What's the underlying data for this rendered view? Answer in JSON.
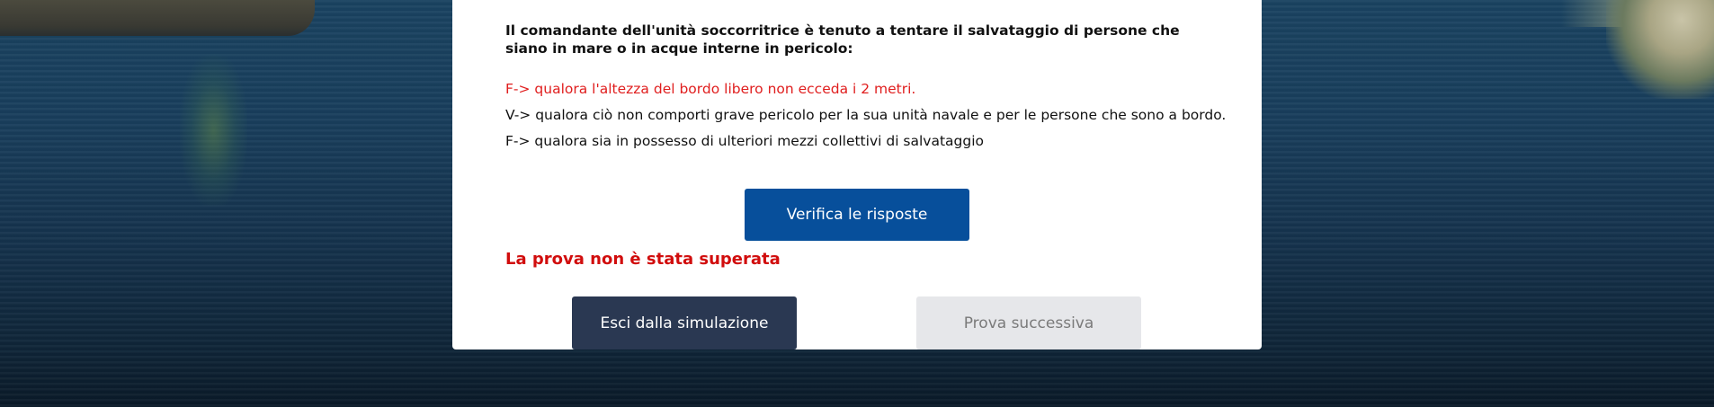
{
  "quiz": {
    "question": "Il comandante dell'unità soccorritrice è tenuto a tentare il salvataggio di persone che siano in mare o in acque interne in pericolo:",
    "answers": [
      {
        "text": "F-> qualora l'altezza del bordo libero non ecceda i 2 metri.",
        "status": "wrong",
        "color": "#e01e1e"
      },
      {
        "text": "V-> qualora ciò non comporti grave pericolo per la sua unità navale e per le persone che sono a bordo.",
        "status": "correct",
        "color": "#111111"
      },
      {
        "text": "F-> qualora sia in possesso di ulteriori mezzi collettivi di salvataggio",
        "status": "correct",
        "color": "#111111"
      }
    ],
    "verify_label": "Verifica le risposte",
    "result_text": "La prova non è stata superata",
    "exit_label": "Esci dalla simulazione",
    "next_label": "Prova successiva",
    "next_disabled": true
  },
  "colors": {
    "primary_button": "#074f9b",
    "exit_button": "#2a3852",
    "disabled_button": "#e6e7ea",
    "error_red": "#d10d0d"
  }
}
